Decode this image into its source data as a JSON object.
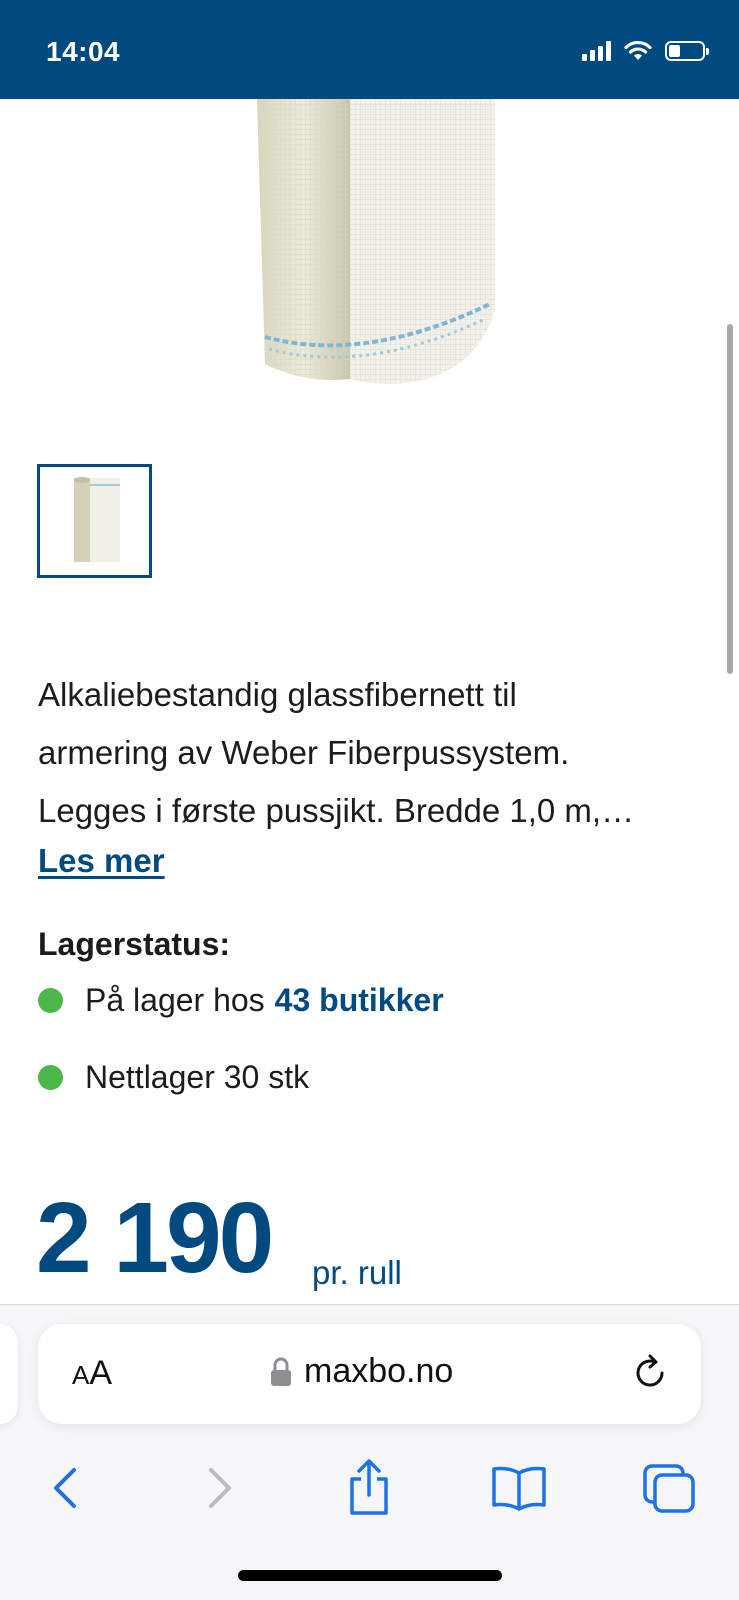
{
  "status_bar": {
    "time": "14:04",
    "icons": [
      "signal-icon",
      "wifi-icon",
      "battery-icon"
    ],
    "battery_level": 0.35,
    "background_color": "#004a7f"
  },
  "product": {
    "image": "glass-fiber-mesh-roll",
    "thumbnail": "glass-fiber-mesh-roll-thumbnail",
    "description": "Alkaliebestandig glassfibernett til\narmering av Weber Fiberpussystem.\nLegges i første pussjikt. Bredde 1,0 m,…",
    "read_more_label": "Les mer",
    "stock_title": "Lagerstatus:",
    "stock_store_prefix": "På lager hos",
    "stock_store_link": "43 butikker",
    "stock_online": "Nettlager 30 stk",
    "price": "2 190",
    "price_unit": "pr. rull"
  },
  "browser": {
    "text_size_label_small": "A",
    "text_size_label_large": "A",
    "url": "maxbo.no",
    "nav_icons": [
      "back-icon",
      "forward-icon",
      "share-icon",
      "bookmarks-icon",
      "tabs-icon"
    ]
  },
  "colors": {
    "brand": "#004a7f",
    "in_stock": "#4cb74a",
    "ios_blue": "#1a73e8"
  }
}
